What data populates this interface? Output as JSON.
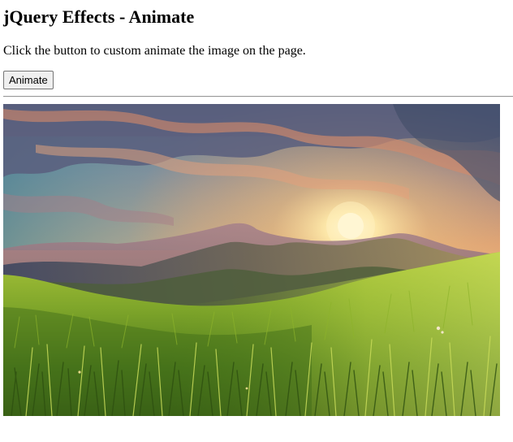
{
  "page": {
    "title": "jQuery Effects - Animate",
    "description": "Click the button to custom animate the image on the page.",
    "animate_button_label": "Animate"
  },
  "image": {
    "subject": "landscape-sunset-mountains-grass",
    "colors": {
      "sky_top": "#5c6a86",
      "sky_warm": "#e9a36c",
      "sun": "#fff4c8",
      "mountain_far": "#8e6d7a",
      "mountain_mid": "#6b5a57",
      "grass_bright": "#b7d23a",
      "grass_dark": "#3f6a17"
    }
  }
}
